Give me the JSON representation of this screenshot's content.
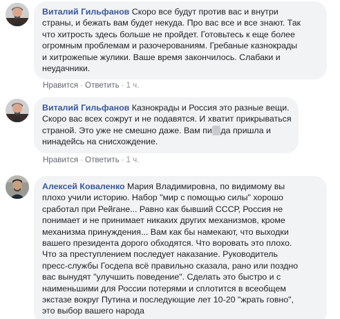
{
  "comments": [
    {
      "author": "Виталий Гильфанов",
      "text_lines": [
        "Скоро все будут против вас и внутри",
        "страны, и бежать вам будет некуда. Про вас все и все знают. Так",
        "что хитрость здесь больше не пройдет. Готовьтесь к еще более",
        "огромным проблемам и разочерованиям. Гребаные казнокрады",
        "и хитрожепые жулики. Ваше время закончилось. Слабаки и",
        "неудачники."
      ],
      "actions": {
        "like": "Нравится",
        "reply": "Ответить",
        "time": "1 ч."
      }
    },
    {
      "author": "Виталий Гильфанов",
      "text_lines": [
        "Казнокрады и Россия это разные вещи.",
        "Скоро вас всех сожрут и не подавятся. И хватит прикрываться",
        "страной. Это уже не смешно даже. Вам пи",
        "да пришла и",
        "нинадейсь на снисхождение."
      ],
      "actions": {
        "like": "Нравится",
        "reply": "Ответить",
        "time": "1 ч."
      }
    },
    {
      "author": "Алексей Коваленко",
      "text_lines": [
        "Мария Владимировна, по видимому вы",
        "плохо учили историю. Набор \"мир с помощью силы\" хорошо",
        "сработал при Рейгане... Равно как бывший СССР, Россия не",
        "понимает и не принимает никаких других механизмов, кроме",
        "механизма принуждения... Вам как бы намекают, что выходки",
        "вашего президента дорого обходятся. Что воровать это плохо.",
        "Что за преступлением последует наказание. Руководитель",
        "пресс-службы Госдепа всё правильно сказала, рано или поздно",
        "вас вынудят \"улучшить поведение\". Сделать это быстро и с",
        "наименьшими для России потерями и сплотится в всеобщем",
        "экстазе вокруг Путина и последующие лет 10-20 \"жрать говно\",",
        "это выбор вашего народа"
      ]
    }
  ],
  "colors": {
    "author": "#385898",
    "bubble": "#f2f3f5",
    "text": "#1c1e21",
    "meta": "#616770"
  },
  "icons": [
    "avatar-photo",
    "avatar-photo",
    "avatar-photo"
  ]
}
